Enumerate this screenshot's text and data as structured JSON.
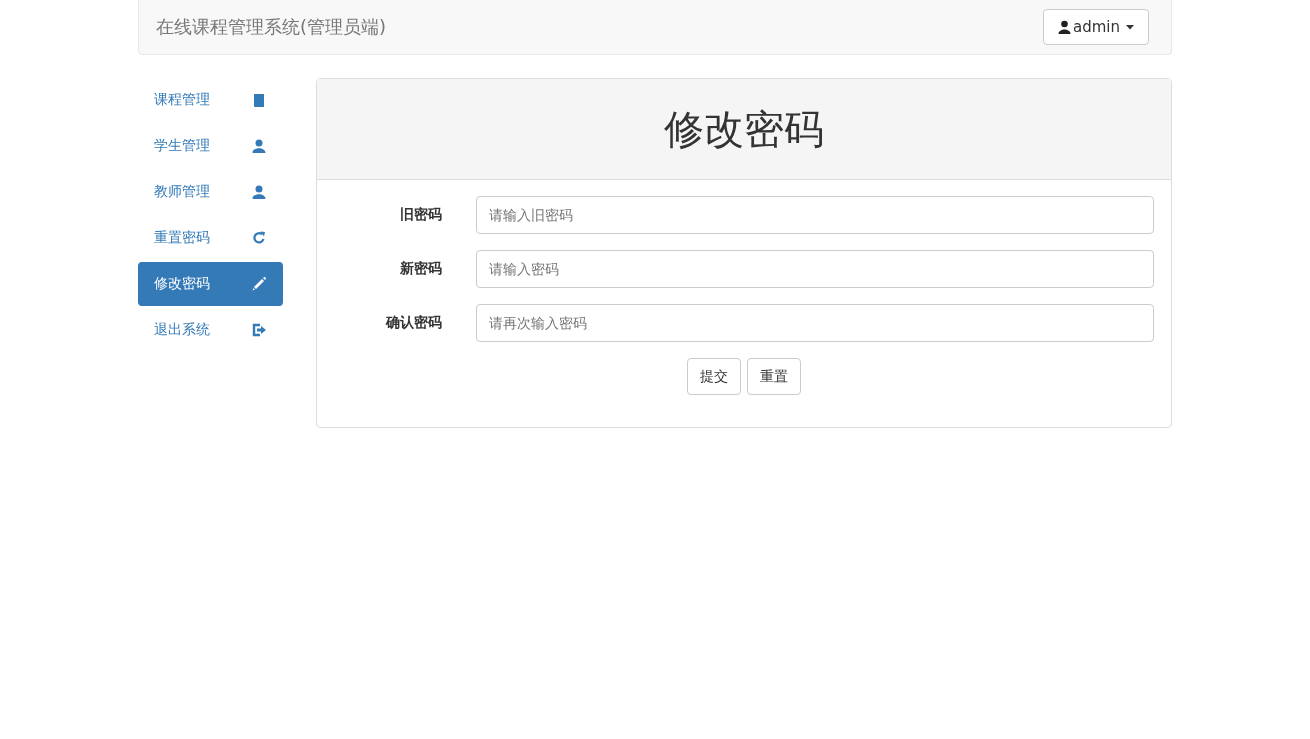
{
  "navbar": {
    "brand": "在线课程管理系统(管理员端)",
    "user_menu": {
      "label": "admin"
    }
  },
  "sidebar": {
    "items": [
      {
        "label": "课程管理",
        "selected": false
      },
      {
        "label": "学生管理",
        "selected": false
      },
      {
        "label": "教师管理",
        "selected": false
      },
      {
        "label": "重置密码",
        "selected": false
      },
      {
        "label": "修改密码",
        "selected": true
      },
      {
        "label": "退出系统",
        "selected": false
      }
    ]
  },
  "panel": {
    "title": "修改密码",
    "fields": [
      {
        "label": "旧密码",
        "placeholder": "请输入旧密码"
      },
      {
        "label": "新密码",
        "placeholder": "请输入密码"
      },
      {
        "label": "确认密码",
        "placeholder": "请再次输入密码"
      }
    ],
    "buttons": [
      "提交",
      "重置"
    ]
  }
}
